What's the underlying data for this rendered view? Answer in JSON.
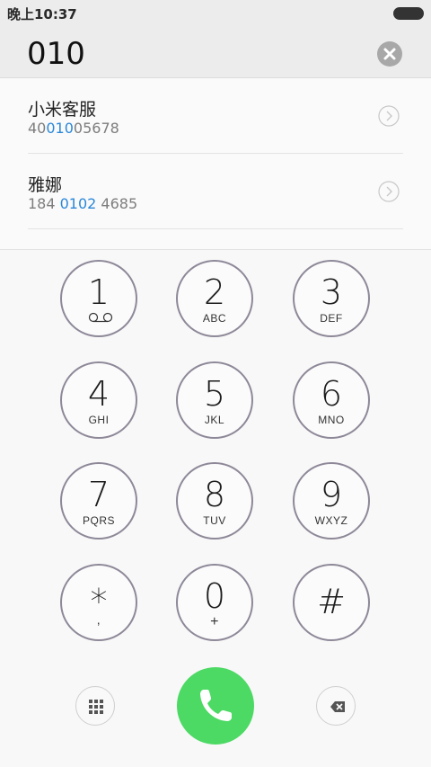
{
  "status_bar": {
    "time": "晚上10:37"
  },
  "dialer": {
    "number": "010"
  },
  "results": [
    {
      "name": "小米客服",
      "number_pre": "40",
      "number_match": "010",
      "number_post": "05678"
    },
    {
      "name": "雅娜",
      "number_pre": "184 ",
      "number_match": "0102",
      "number_post": " 4685"
    }
  ],
  "keypad": [
    {
      "digit": "1",
      "letters": ""
    },
    {
      "digit": "2",
      "letters": "ABC"
    },
    {
      "digit": "3",
      "letters": "DEF"
    },
    {
      "digit": "4",
      "letters": "GHI"
    },
    {
      "digit": "5",
      "letters": "JKL"
    },
    {
      "digit": "6",
      "letters": "MNO"
    },
    {
      "digit": "7",
      "letters": "PQRS"
    },
    {
      "digit": "8",
      "letters": "TUV"
    },
    {
      "digit": "9",
      "letters": "WXYZ"
    },
    {
      "digit": "*",
      "letters": ","
    },
    {
      "digit": "0",
      "letters": "+"
    },
    {
      "digit": "#",
      "letters": ""
    }
  ],
  "colors": {
    "call": "#4cd964",
    "match": "#2b88d8",
    "key_border": "#8e8898"
  },
  "icons": {
    "voicemail": "voicemail-icon",
    "clear": "clear-icon",
    "detail": "chevron-right-icon",
    "keypad_toggle": "keypad-grid-icon",
    "call": "phone-icon",
    "backspace": "backspace-icon"
  }
}
